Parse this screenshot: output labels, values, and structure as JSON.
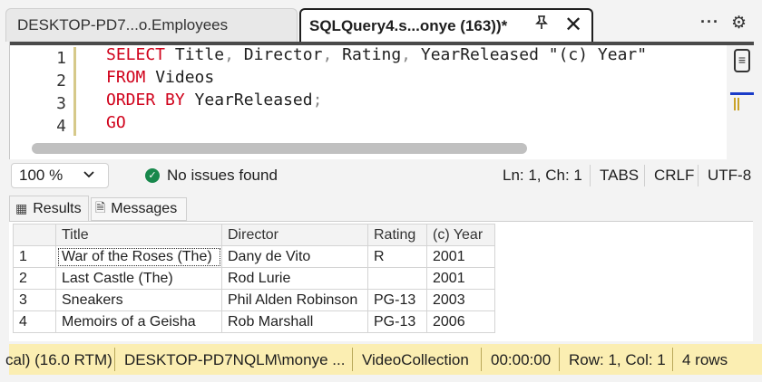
{
  "tabs": {
    "inactive_label": "DESKTOP-PD7...o.Employees",
    "active_label": "SQLQuery4.s...onye (163))*",
    "pin_glyph": "📌",
    "close_glyph": "✕",
    "more_glyph": "···",
    "settings_glyph": "⚙"
  },
  "editor": {
    "line_numbers": [
      "1",
      "2",
      "3",
      "4"
    ],
    "lines": [
      {
        "kw": "SELECT",
        "rest": [
          {
            "t": "Title",
            "p": ","
          },
          {
            "t": "Director",
            "p": ","
          },
          {
            "t": "Rating",
            "p": ","
          },
          {
            "t": "YearReleased \"(c) Year\"",
            "p": ""
          }
        ]
      },
      {
        "kw": "FROM",
        "text": "Videos"
      },
      {
        "kw": "ORDER BY",
        "text": "YearReleased",
        "p": ";"
      },
      {
        "kw": "GO",
        "text": ""
      }
    ]
  },
  "editor_status": {
    "zoom": "100 %",
    "issues": "No issues found",
    "position": "Ln: 1, Ch: 1",
    "indent": "TABS",
    "line_ending": "CRLF",
    "encoding": "UTF-8"
  },
  "results_tabs": {
    "results": "Results",
    "messages": "Messages"
  },
  "grid": {
    "columns": [
      "Title",
      "Director",
      "Rating",
      "(c) Year"
    ],
    "rows": [
      {
        "n": "1",
        "cells": [
          "War of the Roses (The)",
          "Dany de Vito",
          "R",
          "2001"
        ]
      },
      {
        "n": "2",
        "cells": [
          "Last Castle (The)",
          "Rod Lurie",
          "",
          "2001"
        ]
      },
      {
        "n": "3",
        "cells": [
          "Sneakers",
          "Phil Alden Robinson",
          "PG-13",
          "2003"
        ]
      },
      {
        "n": "4",
        "cells": [
          "Memoirs of a Geisha",
          "Rob Marshall",
          "PG-13",
          "2006"
        ]
      }
    ]
  },
  "statusbar": {
    "server_version": "cal) (16.0 RTM)",
    "connection": "DESKTOP-PD7NQLM\\monye ...",
    "database": "VideoCollection",
    "elapsed": "00:00:00",
    "position": "Row: 1, Col: 1",
    "row_count": "4 rows",
    "color": "#fbeeb2"
  }
}
